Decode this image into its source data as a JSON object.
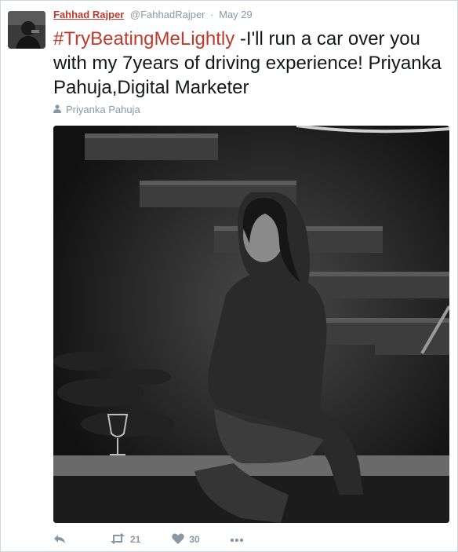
{
  "tweet": {
    "author_name": "Fahhad Rajper",
    "handle": "@FahhadRajper",
    "separator": "·",
    "date": "May 29",
    "hashtag": "#TryBeatingMeLightly",
    "body_text": " -I'll run a car over you with my 7years of driving experience! Priyanka Pahuja,Digital Marketer",
    "tagged_person": "Priyanka Pahuja"
  },
  "actions": {
    "retweet_count": "21",
    "like_count": "30"
  },
  "icons": {
    "reply": "reply-icon",
    "retweet": "retweet-icon",
    "like": "heart-icon",
    "more": "more-icon",
    "person": "person-icon"
  },
  "colors": {
    "accent": "#c0392b",
    "muted": "#8899a6",
    "text": "#14171a"
  }
}
